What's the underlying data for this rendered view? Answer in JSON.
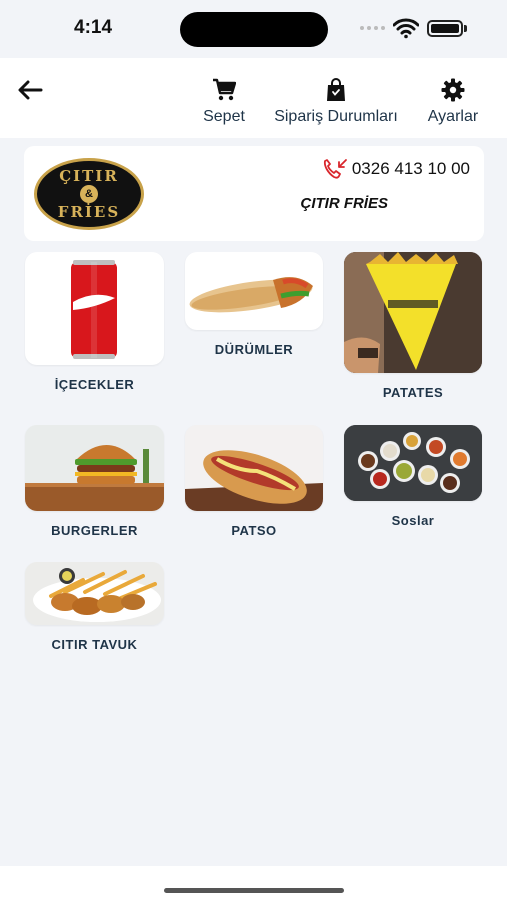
{
  "status": {
    "time": "4:14"
  },
  "toolbar": {
    "cart_label": "Sepet",
    "orders_label": "Sipariş Durumları",
    "settings_label": "Ayarlar"
  },
  "store": {
    "logo_top": "ÇITIR",
    "logo_amp": "&",
    "logo_bottom": "FRİES",
    "phone": "0326 413 10 00",
    "name": "ÇITIR FRİES"
  },
  "categories": [
    {
      "label": "İÇECEKLER",
      "image": "cola-can"
    },
    {
      "label": "DÜRÜMLER",
      "image": "wrap"
    },
    {
      "label": "PATATES",
      "image": "fries-cone"
    },
    {
      "label": "BURGERLER",
      "image": "burger"
    },
    {
      "label": "PATSO",
      "image": "hotdog-sandwich"
    },
    {
      "label": "Soslar",
      "image": "sauce-bowls"
    },
    {
      "label": "CITIR TAVUK",
      "image": "crispy-chicken"
    }
  ],
  "colors": {
    "background": "#f2f4f8",
    "card": "#ffffff",
    "text": "#1f3448",
    "phone_icon": "#d9262c",
    "logo_gold": "#d8b35a"
  }
}
